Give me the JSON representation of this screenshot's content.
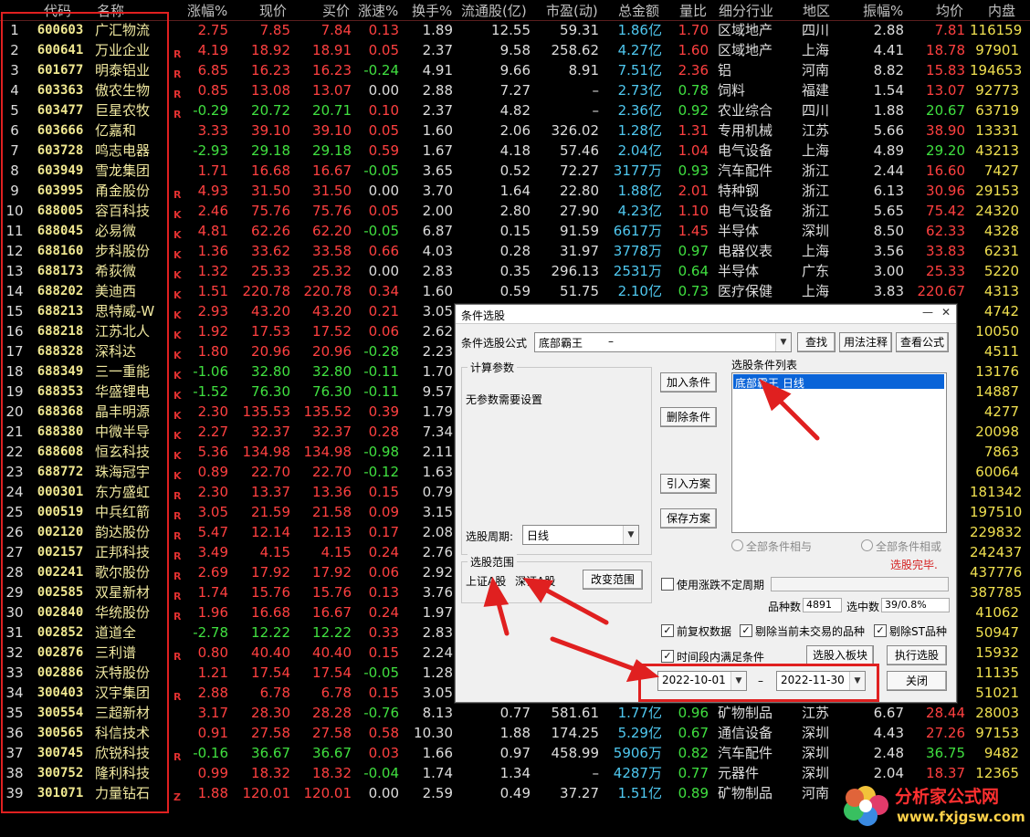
{
  "columns": [
    "代码",
    "名称",
    "涨幅%",
    "现价",
    "买价",
    "涨速%",
    "换手%",
    "流通股(亿)",
    "市盈(动)",
    "总金额",
    "量比",
    "细分行业",
    "地区",
    "振幅%",
    "均价",
    "内盘"
  ],
  "rows": [
    {
      "idx": "1",
      "code": "600603",
      "name": "广汇物流",
      "flag": "",
      "chg": "2.75",
      "price": "7.85",
      "bid": "7.84",
      "speed": "0.13",
      "turn": "1.89",
      "float": "12.55",
      "pe": "59.31",
      "amt": "1.86",
      "amt_unit": "亿",
      "vol": "1.70",
      "ind": "区域地产",
      "reg": "四川",
      "amp": "2.88",
      "avg": "7.81",
      "inner": "116159",
      "cc": "up",
      "sc": "up",
      "vc": "up"
    },
    {
      "idx": "2",
      "code": "600641",
      "name": "万业企业",
      "flag": "R",
      "chg": "4.19",
      "price": "18.92",
      "bid": "18.91",
      "speed": "0.05",
      "turn": "2.37",
      "float": "9.58",
      "pe": "258.62",
      "amt": "4.27",
      "amt_unit": "亿",
      "vol": "1.60",
      "ind": "区域地产",
      "reg": "上海",
      "amp": "4.41",
      "avg": "18.78",
      "inner": "97901",
      "cc": "up",
      "sc": "up",
      "vc": "up"
    },
    {
      "idx": "3",
      "code": "601677",
      "name": "明泰铝业",
      "flag": "R",
      "chg": "6.85",
      "price": "16.23",
      "bid": "16.23",
      "speed": "-0.24",
      "turn": "4.91",
      "float": "9.66",
      "pe": "8.91",
      "amt": "7.51",
      "amt_unit": "亿",
      "vol": "2.36",
      "ind": "铝",
      "reg": "河南",
      "amp": "8.82",
      "avg": "15.83",
      "inner": "194653",
      "cc": "up",
      "sc": "dn",
      "vc": "up"
    },
    {
      "idx": "4",
      "code": "603363",
      "name": "傲农生物",
      "flag": "R",
      "chg": "0.85",
      "price": "13.08",
      "bid": "13.07",
      "speed": "0.00",
      "turn": "2.88",
      "float": "7.27",
      "pe": "–",
      "amt": "2.73",
      "amt_unit": "亿",
      "vol": "0.78",
      "ind": "饲料",
      "reg": "福建",
      "amp": "1.54",
      "avg": "13.07",
      "inner": "92773",
      "cc": "up",
      "sc": "flat",
      "vc": "dn"
    },
    {
      "idx": "5",
      "code": "603477",
      "name": "巨星农牧",
      "flag": "R",
      "chg": "-0.29",
      "price": "20.72",
      "bid": "20.71",
      "speed": "0.10",
      "turn": "2.37",
      "float": "4.82",
      "pe": "–",
      "amt": "2.36",
      "amt_unit": "亿",
      "vol": "0.92",
      "ind": "农业综合",
      "reg": "四川",
      "amp": "1.88",
      "avg": "20.67",
      "inner": "63719",
      "cc": "dn",
      "sc": "up",
      "vc": "dn"
    },
    {
      "idx": "6",
      "code": "603666",
      "name": "亿嘉和",
      "flag": "",
      "chg": "3.33",
      "price": "39.10",
      "bid": "39.10",
      "speed": "0.05",
      "turn": "1.60",
      "float": "2.06",
      "pe": "326.02",
      "amt": "1.28",
      "amt_unit": "亿",
      "vol": "1.31",
      "ind": "专用机械",
      "reg": "江苏",
      "amp": "5.66",
      "avg": "38.90",
      "inner": "13331",
      "cc": "up",
      "sc": "up",
      "vc": "up"
    },
    {
      "idx": "7",
      "code": "603728",
      "name": "鸣志电器",
      "flag": "",
      "chg": "-2.93",
      "price": "29.18",
      "bid": "29.18",
      "speed": "0.59",
      "turn": "1.67",
      "float": "4.18",
      "pe": "57.46",
      "amt": "2.04",
      "amt_unit": "亿",
      "vol": "1.04",
      "ind": "电气设备",
      "reg": "上海",
      "amp": "4.89",
      "avg": "29.20",
      "inner": "43213",
      "cc": "dn",
      "sc": "up",
      "vc": "up"
    },
    {
      "idx": "8",
      "code": "603949",
      "name": "雪龙集团",
      "flag": "",
      "chg": "1.71",
      "price": "16.68",
      "bid": "16.67",
      "speed": "-0.05",
      "turn": "3.65",
      "float": "0.52",
      "pe": "72.27",
      "amt": "3177",
      "amt_unit": "万",
      "vol": "0.93",
      "ind": "汽车配件",
      "reg": "浙江",
      "amp": "2.44",
      "avg": "16.60",
      "inner": "7427",
      "cc": "up",
      "sc": "dn",
      "vc": "dn"
    },
    {
      "idx": "9",
      "code": "603995",
      "name": "甬金股份",
      "flag": "R",
      "chg": "4.93",
      "price": "31.50",
      "bid": "31.50",
      "speed": "0.00",
      "turn": "3.70",
      "float": "1.64",
      "pe": "22.80",
      "amt": "1.88",
      "amt_unit": "亿",
      "vol": "2.01",
      "ind": "特种钢",
      "reg": "浙江",
      "amp": "6.13",
      "avg": "30.96",
      "inner": "29153",
      "cc": "up",
      "sc": "flat",
      "vc": "up"
    },
    {
      "idx": "10",
      "code": "688005",
      "name": "容百科技",
      "flag": "K",
      "chg": "2.46",
      "price": "75.76",
      "bid": "75.76",
      "speed": "0.05",
      "turn": "2.00",
      "float": "2.80",
      "pe": "27.90",
      "amt": "4.23",
      "amt_unit": "亿",
      "vol": "1.10",
      "ind": "电气设备",
      "reg": "浙江",
      "amp": "5.65",
      "avg": "75.42",
      "inner": "24320",
      "cc": "up",
      "sc": "up",
      "vc": "up"
    },
    {
      "idx": "11",
      "code": "688045",
      "name": "必易微",
      "flag": "K",
      "chg": "4.81",
      "price": "62.26",
      "bid": "62.20",
      "speed": "-0.05",
      "turn": "6.87",
      "float": "0.15",
      "pe": "91.59",
      "amt": "6617",
      "amt_unit": "万",
      "vol": "1.45",
      "ind": "半导体",
      "reg": "深圳",
      "amp": "8.50",
      "avg": "62.33",
      "inner": "4328",
      "cc": "up",
      "sc": "dn",
      "vc": "up"
    },
    {
      "idx": "12",
      "code": "688160",
      "name": "步科股份",
      "flag": "K",
      "chg": "1.36",
      "price": "33.62",
      "bid": "33.58",
      "speed": "0.66",
      "turn": "4.03",
      "float": "0.28",
      "pe": "31.97",
      "amt": "3778",
      "amt_unit": "万",
      "vol": "0.97",
      "ind": "电器仪表",
      "reg": "上海",
      "amp": "3.56",
      "avg": "33.83",
      "inner": "6231",
      "cc": "up",
      "sc": "up",
      "vc": "dn"
    },
    {
      "idx": "13",
      "code": "688173",
      "name": "希荻微",
      "flag": "K",
      "chg": "1.32",
      "price": "25.33",
      "bid": "25.32",
      "speed": "0.00",
      "turn": "2.83",
      "float": "0.35",
      "pe": "296.13",
      "amt": "2531",
      "amt_unit": "万",
      "vol": "0.64",
      "ind": "半导体",
      "reg": "广东",
      "amp": "3.00",
      "avg": "25.33",
      "inner": "5220",
      "cc": "up",
      "sc": "flat",
      "vc": "dn"
    },
    {
      "idx": "14",
      "code": "688202",
      "name": "美迪西",
      "flag": "K",
      "chg": "1.51",
      "price": "220.78",
      "bid": "220.78",
      "speed": "0.34",
      "turn": "1.60",
      "float": "0.59",
      "pe": "51.75",
      "amt": "2.10",
      "amt_unit": "亿",
      "vol": "0.73",
      "ind": "医疗保健",
      "reg": "上海",
      "amp": "3.83",
      "avg": "220.67",
      "inner": "4313",
      "cc": "up",
      "sc": "up",
      "vc": "dn"
    },
    {
      "idx": "15",
      "code": "688213",
      "name": "思特威-W",
      "flag": "K",
      "chg": "2.93",
      "price": "43.20",
      "bid": "43.20",
      "speed": "0.21",
      "turn": "3.05",
      "float": "",
      "pe": "",
      "amt": "",
      "amt_unit": "",
      "vol": "",
      "ind": "",
      "reg": "",
      "amp": "",
      "avg": "",
      "inner": "4742",
      "cc": "up",
      "sc": "up",
      "vc": "up"
    },
    {
      "idx": "16",
      "code": "688218",
      "name": "江苏北人",
      "flag": "K",
      "chg": "1.92",
      "price": "17.53",
      "bid": "17.52",
      "speed": "0.06",
      "turn": "2.62",
      "float": "",
      "pe": "",
      "amt": "",
      "amt_unit": "",
      "vol": "",
      "ind": "",
      "reg": "",
      "amp": "",
      "avg": "",
      "inner": "10050",
      "cc": "up",
      "sc": "up",
      "vc": "up"
    },
    {
      "idx": "17",
      "code": "688328",
      "name": "深科达",
      "flag": "K",
      "chg": "1.80",
      "price": "20.96",
      "bid": "20.96",
      "speed": "-0.28",
      "turn": "2.23",
      "float": "",
      "pe": "",
      "amt": "",
      "amt_unit": "",
      "vol": "",
      "ind": "",
      "reg": "",
      "amp": "",
      "avg": "",
      "inner": "4511",
      "cc": "up",
      "sc": "dn",
      "vc": "up"
    },
    {
      "idx": "18",
      "code": "688349",
      "name": "三一重能",
      "flag": "K",
      "chg": "-1.06",
      "price": "32.80",
      "bid": "32.80",
      "speed": "-0.11",
      "turn": "1.70",
      "float": "",
      "pe": "",
      "amt": "",
      "amt_unit": "",
      "vol": "",
      "ind": "",
      "reg": "",
      "amp": "",
      "avg": "",
      "inner": "13176",
      "cc": "dn",
      "sc": "dn",
      "vc": "up"
    },
    {
      "idx": "19",
      "code": "688353",
      "name": "华盛锂电",
      "flag": "K",
      "chg": "-1.52",
      "price": "76.30",
      "bid": "76.30",
      "speed": "-0.11",
      "turn": "9.57",
      "float": "",
      "pe": "",
      "amt": "",
      "amt_unit": "",
      "vol": "",
      "ind": "",
      "reg": "",
      "amp": "",
      "avg": "",
      "inner": "14887",
      "cc": "dn",
      "sc": "dn",
      "vc": "up"
    },
    {
      "idx": "20",
      "code": "688368",
      "name": "晶丰明源",
      "flag": "K",
      "chg": "2.30",
      "price": "135.53",
      "bid": "135.52",
      "speed": "0.39",
      "turn": "1.79",
      "float": "",
      "pe": "",
      "amt": "",
      "amt_unit": "",
      "vol": "",
      "ind": "",
      "reg": "",
      "amp": "",
      "avg": "",
      "inner": "4277",
      "cc": "up",
      "sc": "up",
      "vc": "up"
    },
    {
      "idx": "21",
      "code": "688380",
      "name": "中微半导",
      "flag": "K",
      "chg": "2.27",
      "price": "32.37",
      "bid": "32.37",
      "speed": "0.28",
      "turn": "7.34",
      "float": "",
      "pe": "",
      "amt": "",
      "amt_unit": "",
      "vol": "",
      "ind": "",
      "reg": "",
      "amp": "",
      "avg": "",
      "inner": "20098",
      "cc": "up",
      "sc": "up",
      "vc": "up"
    },
    {
      "idx": "22",
      "code": "688608",
      "name": "恒玄科技",
      "flag": "K",
      "chg": "5.36",
      "price": "134.98",
      "bid": "134.98",
      "speed": "-0.98",
      "turn": "2.11",
      "float": "",
      "pe": "",
      "amt": "",
      "amt_unit": "",
      "vol": "",
      "ind": "",
      "reg": "",
      "amp": "",
      "avg": "",
      "inner": "7863",
      "cc": "up",
      "sc": "dn",
      "vc": "up"
    },
    {
      "idx": "23",
      "code": "688772",
      "name": "珠海冠宇",
      "flag": "K",
      "chg": "0.89",
      "price": "22.70",
      "bid": "22.70",
      "speed": "-0.12",
      "turn": "1.63",
      "float": "",
      "pe": "",
      "amt": "",
      "amt_unit": "",
      "vol": "",
      "ind": "",
      "reg": "",
      "amp": "",
      "avg": "",
      "inner": "60064",
      "cc": "up",
      "sc": "dn",
      "vc": "up"
    },
    {
      "idx": "24",
      "code": "000301",
      "name": "东方盛虹",
      "flag": "R",
      "chg": "2.30",
      "price": "13.37",
      "bid": "13.36",
      "speed": "0.15",
      "turn": "0.79",
      "float": "",
      "pe": "",
      "amt": "",
      "amt_unit": "",
      "vol": "",
      "ind": "",
      "reg": "",
      "amp": "",
      "avg": "",
      "inner": "181342",
      "cc": "up",
      "sc": "up",
      "vc": "up"
    },
    {
      "idx": "25",
      "code": "000519",
      "name": "中兵红箭",
      "flag": "R",
      "chg": "3.05",
      "price": "21.59",
      "bid": "21.58",
      "speed": "0.09",
      "turn": "3.15",
      "float": "",
      "pe": "",
      "amt": "",
      "amt_unit": "",
      "vol": "",
      "ind": "",
      "reg": "",
      "amp": "",
      "avg": "",
      "inner": "197510",
      "cc": "up",
      "sc": "up",
      "vc": "up"
    },
    {
      "idx": "26",
      "code": "002120",
      "name": "韵达股份",
      "flag": "R",
      "chg": "5.47",
      "price": "12.14",
      "bid": "12.13",
      "speed": "0.17",
      "turn": "2.08",
      "float": "",
      "pe": "",
      "amt": "",
      "amt_unit": "",
      "vol": "",
      "ind": "",
      "reg": "",
      "amp": "",
      "avg": "",
      "inner": "229832",
      "cc": "up",
      "sc": "up",
      "vc": "up"
    },
    {
      "idx": "27",
      "code": "002157",
      "name": "正邦科技",
      "flag": "R",
      "chg": "3.49",
      "price": "4.15",
      "bid": "4.15",
      "speed": "0.24",
      "turn": "2.76",
      "float": "",
      "pe": "",
      "amt": "",
      "amt_unit": "",
      "vol": "",
      "ind": "",
      "reg": "",
      "amp": "",
      "avg": "",
      "inner": "242437",
      "cc": "up",
      "sc": "up",
      "vc": "up"
    },
    {
      "idx": "28",
      "code": "002241",
      "name": "歌尔股份",
      "flag": "R",
      "chg": "2.69",
      "price": "17.92",
      "bid": "17.92",
      "speed": "0.06",
      "turn": "2.92",
      "float": "",
      "pe": "",
      "amt": "",
      "amt_unit": "",
      "vol": "",
      "ind": "",
      "reg": "",
      "amp": "",
      "avg": "",
      "inner": "437776",
      "cc": "up",
      "sc": "up",
      "vc": "up"
    },
    {
      "idx": "29",
      "code": "002585",
      "name": "双星新材",
      "flag": "R",
      "chg": "1.74",
      "price": "15.76",
      "bid": "15.76",
      "speed": "0.13",
      "turn": "3.76",
      "float": "",
      "pe": "",
      "amt": "",
      "amt_unit": "",
      "vol": "",
      "ind": "",
      "reg": "",
      "amp": "",
      "avg": "",
      "inner": "387785",
      "cc": "up",
      "sc": "up",
      "vc": "up"
    },
    {
      "idx": "30",
      "code": "002840",
      "name": "华统股份",
      "flag": "R",
      "chg": "1.96",
      "price": "16.68",
      "bid": "16.67",
      "speed": "0.24",
      "turn": "1.97",
      "float": "",
      "pe": "",
      "amt": "",
      "amt_unit": "",
      "vol": "",
      "ind": "",
      "reg": "",
      "amp": "",
      "avg": "",
      "inner": "41062",
      "cc": "up",
      "sc": "up",
      "vc": "up"
    },
    {
      "idx": "31",
      "code": "002852",
      "name": "道道全",
      "flag": "",
      "chg": "-2.78",
      "price": "12.22",
      "bid": "12.22",
      "speed": "0.33",
      "turn": "2.83",
      "float": "",
      "pe": "",
      "amt": "",
      "amt_unit": "",
      "vol": "",
      "ind": "",
      "reg": "",
      "amp": "",
      "avg": "",
      "inner": "50947",
      "cc": "dn",
      "sc": "up",
      "vc": "up"
    },
    {
      "idx": "32",
      "code": "002876",
      "name": "三利谱",
      "flag": "R",
      "chg": "0.80",
      "price": "40.40",
      "bid": "40.40",
      "speed": "0.15",
      "turn": "2.24",
      "float": "",
      "pe": "",
      "amt": "",
      "amt_unit": "",
      "vol": "",
      "ind": "",
      "reg": "",
      "amp": "",
      "avg": "",
      "inner": "15932",
      "cc": "up",
      "sc": "up",
      "vc": "up"
    },
    {
      "idx": "33",
      "code": "002886",
      "name": "沃特股份",
      "flag": "",
      "chg": "1.21",
      "price": "17.54",
      "bid": "17.54",
      "speed": "-0.05",
      "turn": "1.28",
      "float": "",
      "pe": "",
      "amt": "",
      "amt_unit": "",
      "vol": "",
      "ind": "",
      "reg": "",
      "amp": "",
      "avg": "",
      "inner": "11135",
      "cc": "up",
      "sc": "dn",
      "vc": "up"
    },
    {
      "idx": "34",
      "code": "300403",
      "name": "汉宇集团",
      "flag": "R",
      "chg": "2.88",
      "price": "6.78",
      "bid": "6.78",
      "speed": "0.15",
      "turn": "3.05",
      "float": "",
      "pe": "",
      "amt": "",
      "amt_unit": "",
      "vol": "",
      "ind": "",
      "reg": "",
      "amp": "",
      "avg": "",
      "inner": "51021",
      "cc": "up",
      "sc": "up",
      "vc": "up"
    },
    {
      "idx": "35",
      "code": "300554",
      "name": "三超新材",
      "flag": "",
      "chg": "3.17",
      "price": "28.30",
      "bid": "28.28",
      "speed": "-0.76",
      "turn": "8.13",
      "float": "0.77",
      "pe": "581.61",
      "amt": "1.77",
      "amt_unit": "亿",
      "vol": "0.96",
      "ind": "矿物制品",
      "reg": "江苏",
      "amp": "6.67",
      "avg": "28.44",
      "inner": "28003",
      "cc": "up",
      "sc": "dn",
      "vc": "dn"
    },
    {
      "idx": "36",
      "code": "300565",
      "name": "科信技术",
      "flag": "",
      "chg": "0.91",
      "price": "27.58",
      "bid": "27.58",
      "speed": "0.58",
      "turn": "10.30",
      "float": "1.88",
      "pe": "174.25",
      "amt": "5.29",
      "amt_unit": "亿",
      "vol": "0.67",
      "ind": "通信设备",
      "reg": "深圳",
      "amp": "4.43",
      "avg": "27.26",
      "inner": "97153",
      "cc": "up",
      "sc": "up",
      "vc": "dn"
    },
    {
      "idx": "37",
      "code": "300745",
      "name": "欣锐科技",
      "flag": "R",
      "chg": "-0.16",
      "price": "36.67",
      "bid": "36.67",
      "speed": "0.03",
      "turn": "1.66",
      "float": "0.97",
      "pe": "458.99",
      "amt": "5906",
      "amt_unit": "万",
      "vol": "0.82",
      "ind": "汽车配件",
      "reg": "深圳",
      "amp": "2.48",
      "avg": "36.75",
      "inner": "9482",
      "cc": "dn",
      "sc": "up",
      "vc": "dn"
    },
    {
      "idx": "38",
      "code": "300752",
      "name": "隆利科技",
      "flag": "",
      "chg": "0.99",
      "price": "18.32",
      "bid": "18.32",
      "speed": "-0.04",
      "turn": "1.74",
      "float": "1.34",
      "pe": "–",
      "amt": "4287",
      "amt_unit": "万",
      "vol": "0.77",
      "ind": "元器件",
      "reg": "深圳",
      "amp": "2.04",
      "avg": "18.37",
      "inner": "12365",
      "cc": "up",
      "sc": "dn",
      "vc": "dn"
    },
    {
      "idx": "39",
      "code": "301071",
      "name": "力量钻石",
      "flag": "Z",
      "chg": "1.88",
      "price": "120.01",
      "bid": "120.01",
      "speed": "0.00",
      "turn": "2.59",
      "float": "0.49",
      "pe": "37.27",
      "amt": "1.51",
      "amt_unit": "亿",
      "vol": "0.89",
      "ind": "矿物制品",
      "reg": "河南",
      "amp": "",
      "avg": "",
      "inner": "",
      "cc": "up",
      "sc": "flat",
      "vc": "dn"
    }
  ],
  "dialog": {
    "title": "条件选股",
    "formula_label": "条件选股公式",
    "formula_value": "底部霸王",
    "formula_dash": "–",
    "btn_find": "查找",
    "btn_usage": "用法注释",
    "btn_view": "查看公式",
    "params_group": "计算参数",
    "params_text": "无参数需要设置",
    "btn_add": "加入条件",
    "btn_delete": "删除条件",
    "btn_import": "引入方案",
    "btn_save": "保存方案",
    "cond_list_label": "选股条件列表",
    "cond_item": "底部霸王   日线",
    "period_label": "选股周期:",
    "period_value": "日线",
    "radio_and": "全部条件相与",
    "radio_or": "全部条件相或",
    "done_text": "选股完毕.",
    "range_group": "选股范围",
    "range_sh": "上证A股",
    "range_sz": "深证A股",
    "btn_change_range": "改变范围",
    "chk_limit": "使用涨跌不定周期",
    "count_label": "品种数",
    "count_value": "4891",
    "selected_label": "选中数",
    "selected_value": "39/0.8%",
    "chk_fq": "前复权数据",
    "chk_exclude": "剔除当前未交易的品种",
    "chk_st": "剔除ST品种",
    "chk_time": "时间段内满足条件",
    "btn_to_block": "选股入板块",
    "btn_execute": "执行选股",
    "date_from": "2022-10-01",
    "date_sep": "–",
    "date_to": "2022-11-30",
    "btn_close": "关闭"
  },
  "watermark": {
    "cn": "分析家公式网",
    "url": "www.fxjgsw.com"
  }
}
